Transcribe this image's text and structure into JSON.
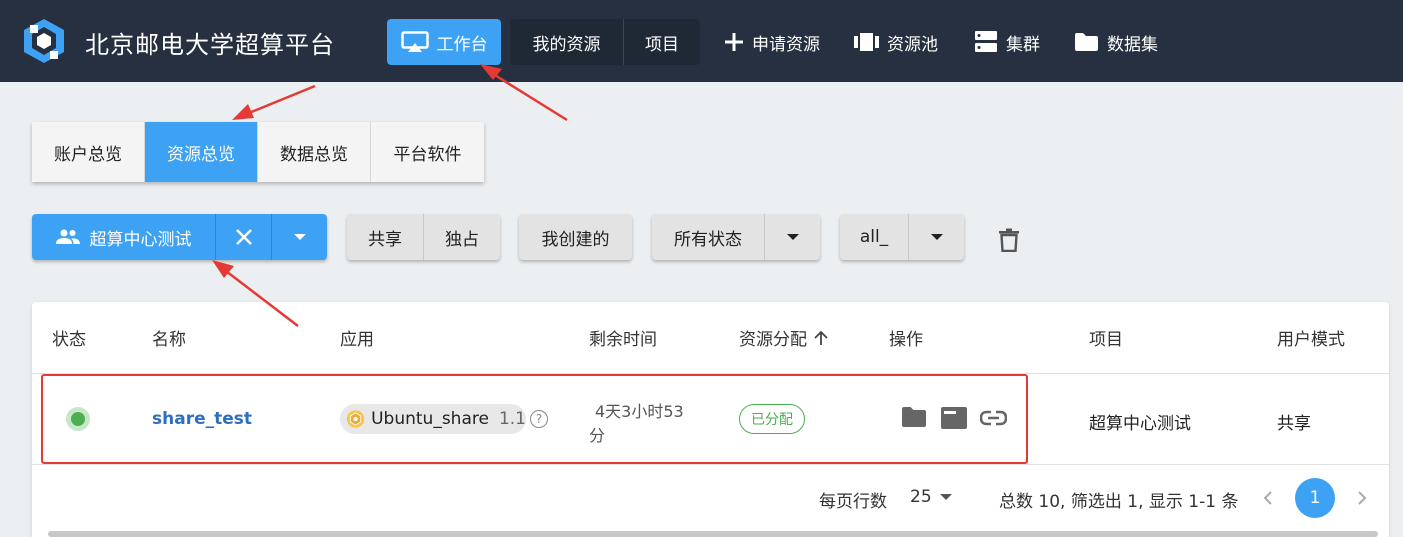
{
  "header": {
    "brand": "北京邮电大学超算平台",
    "workbench": "工作台",
    "my_resources": "我的资源",
    "projects": "项目",
    "apply_resource": "申请资源",
    "resource_pool": "资源池",
    "cluster": "集群",
    "dataset": "数据集"
  },
  "tabs": [
    "账户总览",
    "资源总览",
    "数据总览",
    "平台软件"
  ],
  "filters": {
    "group": "超算中心测试",
    "share": "共享",
    "exclusive": "独占",
    "created_by_me": "我创建的",
    "all_status": "所有状态",
    "all": "all_"
  },
  "table": {
    "headers": [
      "状态",
      "名称",
      "应用",
      "剩余时间",
      "资源分配",
      "操作",
      "项目",
      "用户模式"
    ],
    "row": {
      "name": "share_test",
      "app": "Ubuntu_share",
      "version": "1.1",
      "help": "?",
      "remaining_line1": "4天3小时53",
      "remaining_line2": "分",
      "allocation": "已分配",
      "project": "超算中心测试",
      "mode": "共享"
    }
  },
  "footer": {
    "rows_per_page_label": "每页行数",
    "rows_per_page": "25",
    "summary": "总数 10, 筛选出 1, 显示 1-1 条",
    "page": "1"
  },
  "colors": {
    "topbar": "#263040",
    "accent": "#3ea2f4",
    "success": "#4caf50",
    "annotation": "#e53935",
    "link": "#2e6fbf"
  },
  "icons": {
    "logo": "cube-logo-icon",
    "workbench": "monitor-icon",
    "apply": "plus-icon",
    "pool": "pool-icon",
    "cluster": "server-icon",
    "dataset": "folder-icon",
    "group": "people-icon",
    "clear": "close-icon",
    "delete": "trash-icon",
    "sort": "arrow-up-icon",
    "ops": [
      "folder-icon",
      "terminal-icon",
      "link-icon"
    ]
  }
}
